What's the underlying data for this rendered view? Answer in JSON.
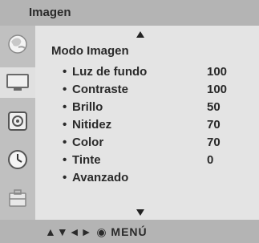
{
  "header": {
    "title": "Imagen"
  },
  "sidebar": {
    "icons": [
      {
        "name": "picture-icon",
        "active": false
      },
      {
        "name": "tv-screen-icon",
        "active": true
      },
      {
        "name": "audio-icon",
        "active": false
      },
      {
        "name": "clock-icon",
        "active": false
      },
      {
        "name": "options-icon",
        "active": false
      }
    ]
  },
  "menu": {
    "heading": "Modo Imagen",
    "bullet": "•",
    "items": [
      {
        "label": "Luz de fundo",
        "value": "100"
      },
      {
        "label": "Contraste",
        "value": "100"
      },
      {
        "label": "Brillo",
        "value": "50"
      },
      {
        "label": "Nitidez",
        "value": "70"
      },
      {
        "label": "Color",
        "value": "70"
      },
      {
        "label": "Tinte",
        "value": "0"
      },
      {
        "label": "Avanzado",
        "value": ""
      }
    ]
  },
  "footer": {
    "hint": "▲▼◄► ◉ MENÚ"
  }
}
